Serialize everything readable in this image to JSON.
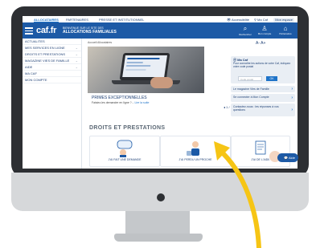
{
  "topbar": {
    "tabs": [
      "ALLOCATAIRES",
      "PARTENAIRES",
      "PRESSE ET INSTITUTIONNEL"
    ],
    "accessibility": "Accessibilité",
    "ma_caf": "Ma Caf",
    "espace": "Mon espace"
  },
  "header": {
    "logo": "caf.fr",
    "tagline_top": "BIENVENUE SUR LE SITE DES",
    "tagline_main": "ALLOCATIONS FAMILIALES",
    "search_label": "Rechercher",
    "account_label": "Mon compte",
    "partner_label": "Partenaires"
  },
  "menu": {
    "items": [
      {
        "label": "ACTUALITES",
        "chevron": false
      },
      {
        "label": "MES SERVICES EN LIGNE",
        "chevron": true
      },
      {
        "label": "DROITS ET PRESTATIONS",
        "chevron": true
      },
      {
        "label": "MAGAZINE VIES DE FAMILLE",
        "chevron": true
      },
      {
        "label": "AIDE",
        "chevron": true
      },
      {
        "label": "MA CAF",
        "chevron": false
      },
      {
        "label": "MON COMPTE",
        "chevron": false
      }
    ]
  },
  "content": {
    "breadcrumb": "Accueil Allocataires",
    "font_size_control": "A- A+",
    "hero_title": "PRIMES EXCEPTIONNELLES",
    "hero_sub": "Faisiez-les demander en ligne ?...",
    "hero_link": "Lire la suite",
    "slider_label": "1 / 5",
    "section_title": "DROITS ET PRESTATIONS",
    "cards": [
      {
        "label": "J'AI FAIT UNE DEMANDE"
      },
      {
        "label": "J'AI PERDU UN PROCHE"
      },
      {
        "label": "J'AI DE L'AIDE"
      }
    ]
  },
  "sidebar": {
    "moncaf_title": "Ma Caf",
    "moncaf_text": "Pour connaître les actions de votre Caf, indiquez votre code postal",
    "moncaf_placeholder": "Code postal",
    "moncaf_ok": "OK",
    "links": [
      "Le magazine Vies de Famille",
      "Se connecter à Mon Compte",
      "Contactez-nous : les réponses à vos questions"
    ]
  },
  "help": {
    "label": "Aide"
  },
  "colors": {
    "brand_blue": "#1d5aa6",
    "link_blue": "#1e73c8",
    "arrow_yellow": "#f6c515",
    "bezel": "#2d2f33"
  }
}
